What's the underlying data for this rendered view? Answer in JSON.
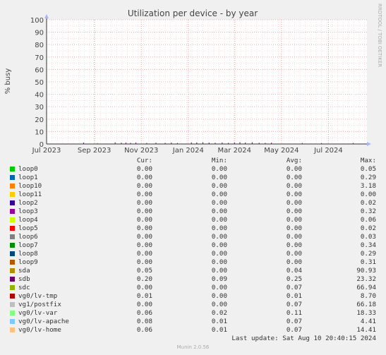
{
  "chart_data": {
    "type": "area",
    "title": "Utilization per device - by year",
    "ylabel": "% busy",
    "watermark": "RRDTOOL / TOBI OETIKER",
    "ylim": [
      0,
      100
    ],
    "yticks": [
      0,
      10,
      20,
      30,
      40,
      50,
      60,
      70,
      80,
      90,
      100
    ],
    "x_range": [
      "2023-07-01",
      "2024-08-20"
    ],
    "x_ticks": [
      {
        "date": "2023-07-01",
        "label": "Jul 2023"
      },
      {
        "date": "2023-09-01",
        "label": "Sep 2023"
      },
      {
        "date": "2023-11-01",
        "label": "Nov 2023"
      },
      {
        "date": "2024-01-01",
        "label": "Jan 2024"
      },
      {
        "date": "2024-03-01",
        "label": "Mar 2024"
      },
      {
        "date": "2024-05-01",
        "label": "May 2024"
      },
      {
        "date": "2024-07-01",
        "label": "Jul 2024"
      }
    ],
    "grid": true,
    "columns": {
      "cur": "Cur:",
      "min": "Min:",
      "avg": "Avg:",
      "max": "Max:"
    },
    "series": [
      {
        "name": "loop0",
        "color": "#00cc00",
        "cur": "0.00",
        "min": "0.00",
        "avg": "0.00",
        "max": "0.05"
      },
      {
        "name": "loop1",
        "color": "#0066b3",
        "cur": "0.00",
        "min": "0.00",
        "avg": "0.00",
        "max": "0.29"
      },
      {
        "name": "loop10",
        "color": "#ff8000",
        "cur": "0.00",
        "min": "0.00",
        "avg": "0.00",
        "max": "3.18"
      },
      {
        "name": "loop11",
        "color": "#ffcc00",
        "cur": "0.00",
        "min": "0.00",
        "avg": "0.00",
        "max": "0.00"
      },
      {
        "name": "loop2",
        "color": "#330099",
        "cur": "0.00",
        "min": "0.00",
        "avg": "0.00",
        "max": "0.02"
      },
      {
        "name": "loop3",
        "color": "#990099",
        "cur": "0.00",
        "min": "0.00",
        "avg": "0.00",
        "max": "0.32"
      },
      {
        "name": "loop4",
        "color": "#ccff00",
        "cur": "0.00",
        "min": "0.00",
        "avg": "0.00",
        "max": "0.06"
      },
      {
        "name": "loop5",
        "color": "#ff0000",
        "cur": "0.00",
        "min": "0.00",
        "avg": "0.00",
        "max": "0.02"
      },
      {
        "name": "loop6",
        "color": "#808080",
        "cur": "0.00",
        "min": "0.00",
        "avg": "0.00",
        "max": "0.03"
      },
      {
        "name": "loop7",
        "color": "#008f00",
        "cur": "0.00",
        "min": "0.00",
        "avg": "0.00",
        "max": "0.34"
      },
      {
        "name": "loop8",
        "color": "#00487d",
        "cur": "0.00",
        "min": "0.00",
        "avg": "0.00",
        "max": "0.29"
      },
      {
        "name": "loop9",
        "color": "#b35a00",
        "cur": "0.00",
        "min": "0.00",
        "avg": "0.00",
        "max": "0.31"
      },
      {
        "name": "sda",
        "color": "#b38f00",
        "cur": "0.05",
        "min": "0.00",
        "avg": "0.04",
        "max": "90.93"
      },
      {
        "name": "sdb",
        "color": "#6b006b",
        "cur": "0.20",
        "min": "0.09",
        "avg": "0.25",
        "max": "23.32"
      },
      {
        "name": "sdc",
        "color": "#8fb300",
        "cur": "0.00",
        "min": "0.00",
        "avg": "0.07",
        "max": "66.94"
      },
      {
        "name": "vg0/lv-tmp",
        "color": "#b30000",
        "cur": "0.01",
        "min": "0.00",
        "avg": "0.01",
        "max": "8.70"
      },
      {
        "name": "vg1/postfix",
        "color": "#bebebe",
        "cur": "0.00",
        "min": "0.00",
        "avg": "0.07",
        "max": "66.18"
      },
      {
        "name": "vg0/lv-var",
        "color": "#80ff80",
        "cur": "0.06",
        "min": "0.02",
        "avg": "0.11",
        "max": "18.33"
      },
      {
        "name": "vg0/lv-apache",
        "color": "#80c9ff",
        "cur": "0.08",
        "min": "0.01",
        "avg": "0.07",
        "max": "4.41"
      },
      {
        "name": "vg0/lv-home",
        "color": "#ffc080",
        "cur": "0.06",
        "min": "0.01",
        "avg": "0.07",
        "max": "14.41"
      }
    ],
    "spikes": [
      {
        "date": "2023-08-18",
        "value": 1.2,
        "series": "sdb"
      },
      {
        "date": "2023-09-05",
        "value": 0.8,
        "series": "sda"
      },
      {
        "date": "2023-09-28",
        "value": 1.3,
        "series": "sdb"
      },
      {
        "date": "2023-10-06",
        "value": 1.0,
        "series": "sdb"
      },
      {
        "date": "2023-10-12",
        "value": 1.1,
        "series": "sdb"
      },
      {
        "date": "2023-10-18",
        "value": 0.9,
        "series": "sdb"
      },
      {
        "date": "2023-10-25",
        "value": 1.2,
        "series": "sdb"
      },
      {
        "date": "2023-11-08",
        "value": 0.8,
        "series": "sdb"
      },
      {
        "date": "2023-11-20",
        "value": 1.0,
        "series": "sdb"
      },
      {
        "date": "2023-12-02",
        "value": 0.9,
        "series": "sdb"
      },
      {
        "date": "2023-12-10",
        "value": 1.1,
        "series": "sdb"
      },
      {
        "date": "2023-12-18",
        "value": 0.8,
        "series": "sdb"
      },
      {
        "date": "2024-01-05",
        "value": 1.3,
        "series": "sdb"
      },
      {
        "date": "2024-01-12",
        "value": 1.2,
        "series": "sdb"
      },
      {
        "date": "2024-01-20",
        "value": 1.4,
        "series": "sdb"
      },
      {
        "date": "2024-01-28",
        "value": 1.1,
        "series": "sdb"
      },
      {
        "date": "2024-02-05",
        "value": 1.0,
        "series": "sdb"
      },
      {
        "date": "2024-02-14",
        "value": 1.2,
        "series": "sdb"
      },
      {
        "date": "2024-02-22",
        "value": 0.9,
        "series": "sdb"
      },
      {
        "date": "2024-03-01",
        "value": 1.2,
        "series": "sdb"
      },
      {
        "date": "2024-03-08",
        "value": 1.4,
        "series": "sdb"
      },
      {
        "date": "2024-03-15",
        "value": 1.1,
        "series": "sdb"
      },
      {
        "date": "2024-03-24",
        "value": 1.3,
        "series": "sdb"
      },
      {
        "date": "2024-04-02",
        "value": 1.0,
        "series": "sdb"
      },
      {
        "date": "2024-04-10",
        "value": 0.9,
        "series": "sdb"
      },
      {
        "date": "2024-04-18",
        "value": 1.1,
        "series": "sdb"
      },
      {
        "date": "2024-05-28",
        "value": 0.8,
        "series": "sdb"
      },
      {
        "date": "2024-06-22",
        "value": 0.7,
        "series": "sdb"
      },
      {
        "date": "2024-08-02",
        "value": 0.8,
        "series": "sdb"
      }
    ]
  },
  "last_update": "Last update: Sat Aug 10 20:40:15 2024",
  "footer": "Munin 2.0.56"
}
